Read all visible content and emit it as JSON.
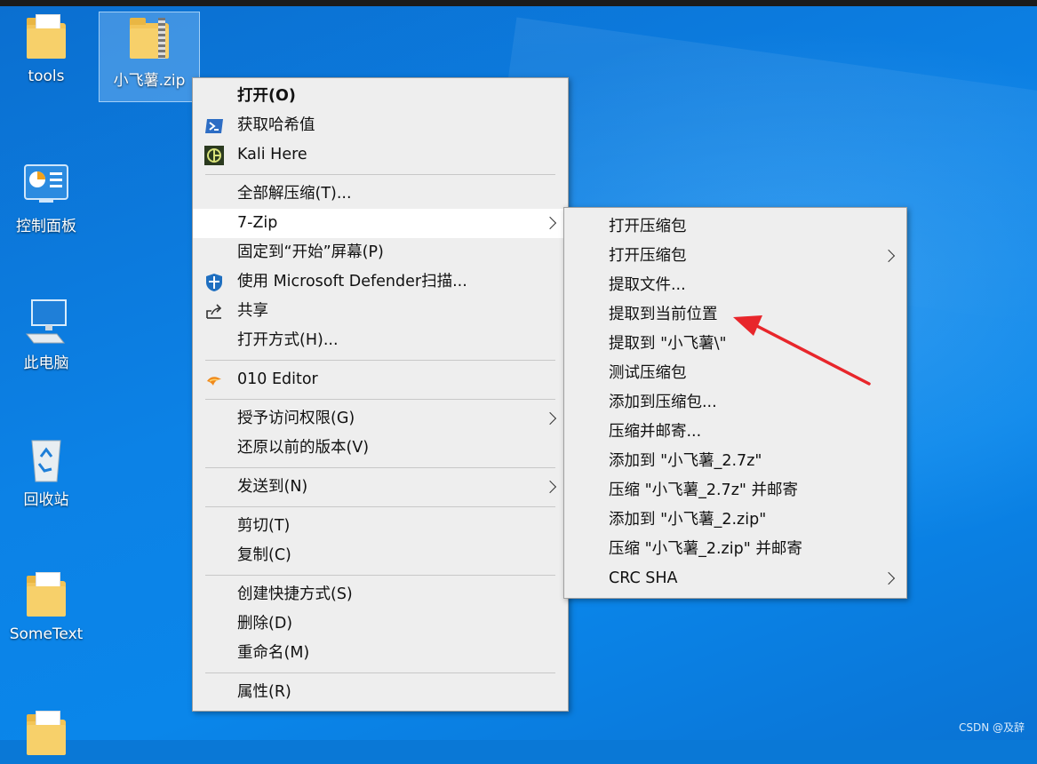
{
  "desktop": {
    "icons": [
      {
        "label": "tools",
        "icon": "folder-icon"
      },
      {
        "label": "小飞薯.zip",
        "icon": "zip-folder-icon"
      },
      {
        "label": "控制面板",
        "icon": "control-panel-icon"
      },
      {
        "label": "此电脑",
        "icon": "computer-icon"
      },
      {
        "label": "回收站",
        "icon": "recycle-bin-icon"
      },
      {
        "label": "SomeText",
        "icon": "folder-icon"
      }
    ]
  },
  "context_menu": {
    "items": [
      {
        "label": "打开(O)"
      },
      {
        "label": "获取哈希值",
        "icon": "powershell-icon"
      },
      {
        "label": "Kali Here",
        "icon": "kali-icon"
      },
      {
        "label": "全部解压缩(T)..."
      },
      {
        "label": "7-Zip"
      },
      {
        "label": "固定到“开始”屏幕(P)"
      },
      {
        "label": "使用 Microsoft Defender扫描...",
        "icon": "defender-shield-icon"
      },
      {
        "label": "共享",
        "icon": "share-icon"
      },
      {
        "label": "打开方式(H)..."
      },
      {
        "label": "010 Editor",
        "icon": "010-editor-icon"
      },
      {
        "label": "授予访问权限(G)"
      },
      {
        "label": "还原以前的版本(V)"
      },
      {
        "label": "发送到(N)"
      },
      {
        "label": "剪切(T)"
      },
      {
        "label": "复制(C)"
      },
      {
        "label": "创建快捷方式(S)"
      },
      {
        "label": "删除(D)"
      },
      {
        "label": "重命名(M)"
      },
      {
        "label": "属性(R)"
      }
    ]
  },
  "submenu_7zip": {
    "items": [
      {
        "label": "打开压缩包"
      },
      {
        "label": "打开压缩包"
      },
      {
        "label": "提取文件..."
      },
      {
        "label": "提取到当前位置"
      },
      {
        "label": "提取到 \"小飞薯\\\""
      },
      {
        "label": "测试压缩包"
      },
      {
        "label": "添加到压缩包..."
      },
      {
        "label": "压缩并邮寄..."
      },
      {
        "label": "添加到 \"小飞薯_2.7z\""
      },
      {
        "label": "压缩 \"小飞薯_2.7z\" 并邮寄"
      },
      {
        "label": "添加到 \"小飞薯_2.zip\""
      },
      {
        "label": "压缩 \"小飞薯_2.zip\" 并邮寄"
      },
      {
        "label": "CRC SHA"
      }
    ]
  },
  "annotation": {
    "color": "#e8262b"
  },
  "watermark": "CSDN @及辞"
}
